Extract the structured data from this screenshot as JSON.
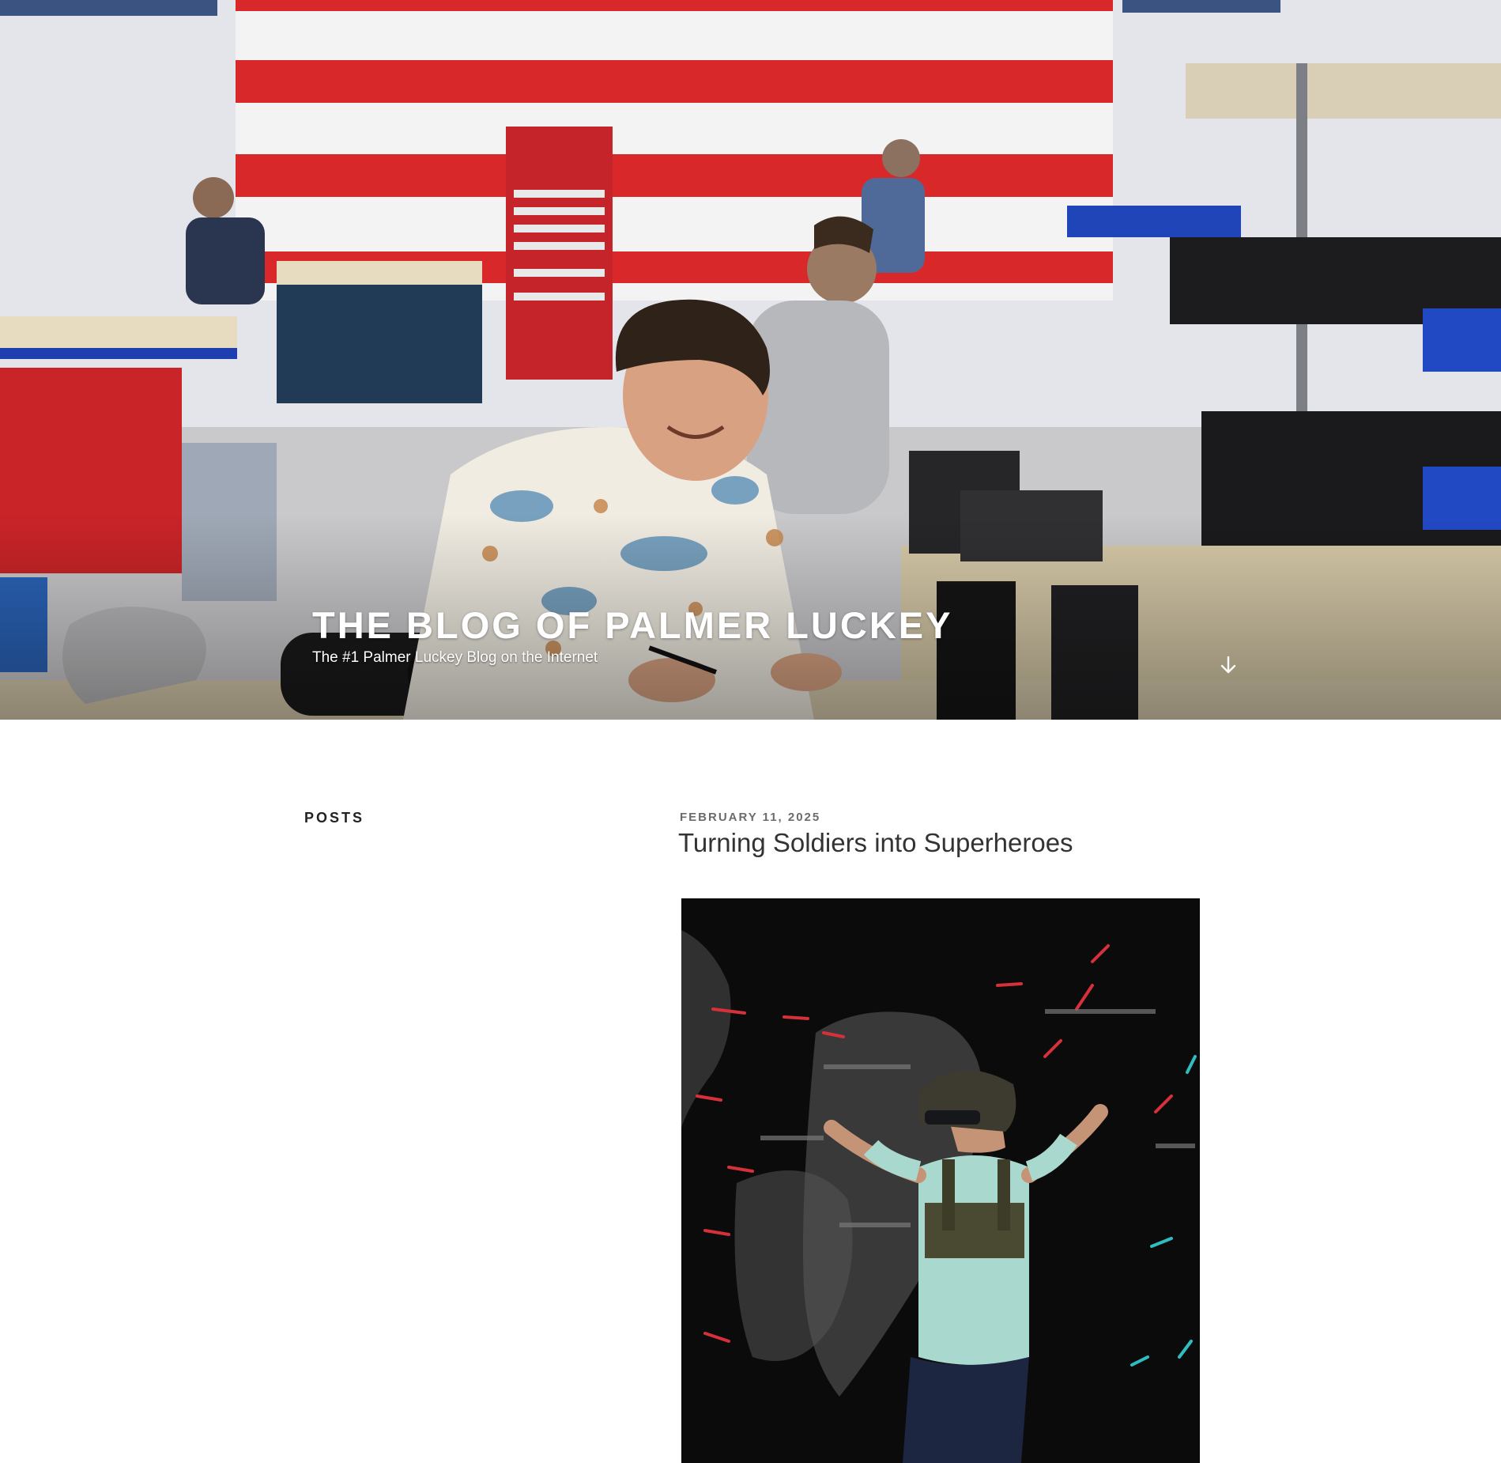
{
  "header": {
    "site_title": "THE BLOG OF PALMER LUCKEY",
    "site_description": "The #1 Palmer Luckey Blog on the Internet",
    "scroll_icon": "arrow-down-icon",
    "image_subject": "hero-workshop-photo"
  },
  "sidebar": {
    "heading": "POSTS"
  },
  "post": {
    "date": "FEBRUARY 11, 2025",
    "title": "Turning Soldiers into Superheroes",
    "image_subject": "featured-image-vr-soldier"
  },
  "colors": {
    "flag_red": "#d9282a",
    "flag_white": "#f4f4f4",
    "flag_blue": "#2a4a8a",
    "bench_blue": "#1f3fb0",
    "title_text": "#333333",
    "meta_text": "#6b6b6b"
  }
}
